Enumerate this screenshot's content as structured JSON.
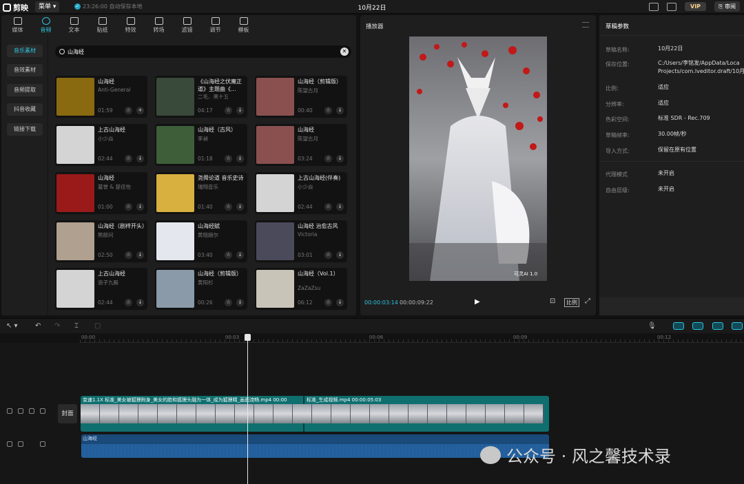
{
  "app": {
    "logo_text": "剪映",
    "menu_label": "菜单",
    "save_status": "23:26:00 自动保存本地",
    "project_title": "10月22日",
    "vip_label": "VIP",
    "review_label": "审阅"
  },
  "tabs": [
    {
      "label": "媒体",
      "icon": "media-icon"
    },
    {
      "label": "音频",
      "icon": "audio-icon"
    },
    {
      "label": "文本",
      "icon": "text-icon"
    },
    {
      "label": "贴纸",
      "icon": "sticker-icon"
    },
    {
      "label": "特效",
      "icon": "effects-icon"
    },
    {
      "label": "转场",
      "icon": "transition-icon"
    },
    {
      "label": "滤镜",
      "icon": "filter-icon"
    },
    {
      "label": "调节",
      "icon": "adjust-icon"
    },
    {
      "label": "模板",
      "icon": "template-icon"
    }
  ],
  "side_nav": [
    "音乐素材",
    "音效素材",
    "音频提取",
    "抖音收藏",
    "链接下载"
  ],
  "search": {
    "value": "山海经"
  },
  "music": [
    {
      "title": "山海经",
      "artist": "Anti-General",
      "duration": "01:59",
      "thumb": "#8a6a10"
    },
    {
      "title": "《山海经之伏魔正道》主题曲《...",
      "artist": "二毛、黑十五",
      "duration": "04:17",
      "thumb": "#3a4a3a"
    },
    {
      "title": "山海经（剪辑版）",
      "artist": "陈望古月",
      "duration": "00:40",
      "thumb": "#8a5050"
    },
    {
      "title": "上古山海经",
      "artist": "小少焱",
      "duration": "02:44",
      "thumb": "#d4d4d4"
    },
    {
      "title": "山海经（古风）",
      "artist": "李昶",
      "duration": "01:18",
      "thumb": "#3e5e3a"
    },
    {
      "title": "山海经",
      "artist": "陈望古月",
      "duration": "03:24",
      "thumb": "#8a5050"
    },
    {
      "title": "山海经",
      "artist": "葛誉 & 楚佳怡",
      "duration": "01:00",
      "thumb": "#9a1a1a"
    },
    {
      "title": "尧舜论道 音乐史诗",
      "artist": "瑞翔音乐",
      "duration": "01:40",
      "thumb": "#d8b040"
    },
    {
      "title": "上古山海经(伴奏)",
      "artist": "小少焱",
      "duration": "02:44",
      "thumb": "#d4d4d4"
    },
    {
      "title": "山海经（剧梓开头）",
      "artist": "熊郎问",
      "duration": "02:50",
      "thumb": "#b0a090"
    },
    {
      "title": "山海经赋",
      "artist": "黄晓婉尔",
      "duration": "03:40",
      "thumb": "#e4e8ee"
    },
    {
      "title": "山海经 治愈古风",
      "artist": "Victoria",
      "duration": "03:01",
      "thumb": "#4a4a5a"
    },
    {
      "title": "上古山海经",
      "artist": "浪子九殿",
      "duration": "02:44",
      "thumb": "#d4d4d4"
    },
    {
      "title": "山海经（剪辑版）",
      "artist": "黄阳杉",
      "duration": "00:26",
      "thumb": "#8a9aa8"
    },
    {
      "title": "山海经（Vol.1）",
      "artist": "ZaZaZsu",
      "duration": "06:12",
      "thumb": "#c8c4b8"
    }
  ],
  "player": {
    "title": "播放器",
    "current_time": "00:00:03:14",
    "total_time": "00:00:09:22",
    "ratio_label": "比例",
    "ai_label": "可灵AI 1.0"
  },
  "draft": {
    "header": "草稿参数",
    "fields": [
      {
        "label": "草稿名称:",
        "value": "10月22日"
      },
      {
        "label": "保存位置:",
        "value": "C:/Users/李铭发/AppData/Loca\nProjects/com.lveditor.draft/10月"
      },
      {
        "label": "比例:",
        "value": "适应"
      },
      {
        "label": "分辨率:",
        "value": "适应"
      },
      {
        "label": "色彩空间:",
        "value": "标准 SDR - Rec.709"
      },
      {
        "label": "草稿帧率:",
        "value": "30.00帧/秒"
      },
      {
        "label": "导入方式:",
        "value": "保留在原有位置"
      },
      {
        "label": "代理模式",
        "value": "未开启"
      },
      {
        "label": "自由层级:",
        "value": "未开启"
      }
    ]
  },
  "timeline": {
    "ticks": [
      "00:00",
      "00:03",
      "00:06",
      "00:09",
      "00:12"
    ],
    "cover_label": "封面",
    "clip1_label": "变速1.1X  标准_美女被狐狸附身_美女的脸和狐狸头融为一体_成为狐狸精_画面流畅.mp4  00:00",
    "clip2_label": "标准_生成视频.mp4  00:00:05:03",
    "audio_label": "山海经"
  },
  "watermark": "公众号 · 风之馨技术录"
}
